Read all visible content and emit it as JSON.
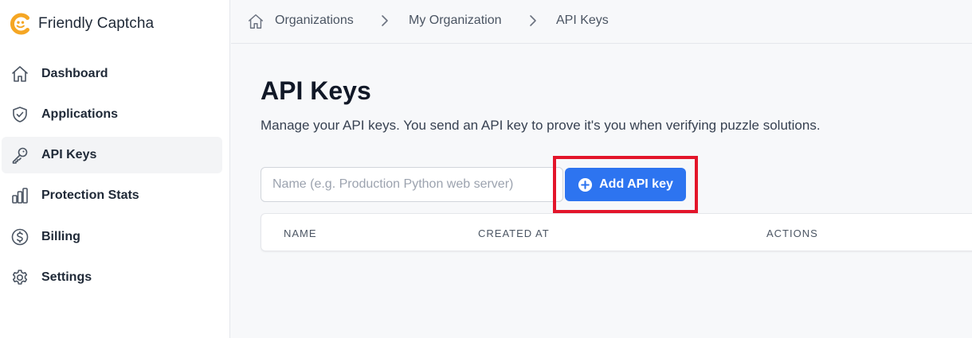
{
  "brand": {
    "name": "Friendly Captcha",
    "accent": "#f5a623"
  },
  "sidebar": {
    "items": [
      {
        "label": "Dashboard",
        "icon": "home-icon"
      },
      {
        "label": "Applications",
        "icon": "shield-icon"
      },
      {
        "label": "API Keys",
        "icon": "key-icon",
        "active": true
      },
      {
        "label": "Protection Stats",
        "icon": "bar-chart-icon"
      },
      {
        "label": "Billing",
        "icon": "dollar-circle-icon"
      },
      {
        "label": "Settings",
        "icon": "gear-icon"
      }
    ]
  },
  "breadcrumb": {
    "items": [
      "Organizations",
      "My Organization",
      "API Keys"
    ]
  },
  "main": {
    "title": "API Keys",
    "subtitle": "Manage your API keys. You send an API key to prove it's you when verifying puzzle solutions.",
    "name_input": {
      "value": "",
      "placeholder": "Name (e.g. Production Python web server)"
    },
    "add_button_label": "Add API key",
    "button_color": "#2d74f0",
    "highlight_color": "#e3152a",
    "table": {
      "columns": [
        "NAME",
        "CREATED AT",
        "ACTIONS"
      ],
      "rows": []
    }
  }
}
